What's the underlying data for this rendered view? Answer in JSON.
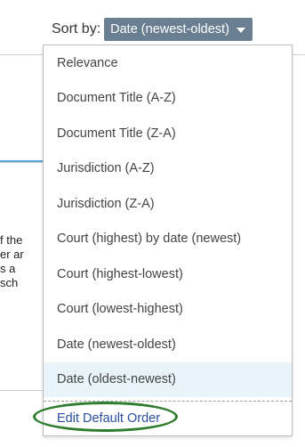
{
  "sort": {
    "label": "Sort by:",
    "selected": "Date (newest-oldest)"
  },
  "menu": {
    "items": [
      {
        "label": "Relevance"
      },
      {
        "label": "Document Title (A-Z)"
      },
      {
        "label": "Document Title (Z-A)"
      },
      {
        "label": "Jurisdiction (A-Z)"
      },
      {
        "label": "Jurisdiction (Z-A)"
      },
      {
        "label": "Court (highest) by date (newest)"
      },
      {
        "label": "Court (highest-lowest)"
      },
      {
        "label": "Court (lowest-highest)"
      },
      {
        "label": "Date (newest-oldest)"
      },
      {
        "label": "Date (oldest-newest)"
      }
    ],
    "edit_label": "Edit Default Order"
  },
  "background": {
    "fragments": [
      "f the",
      "er ar",
      "s a",
      "sch"
    ]
  },
  "colors": {
    "select_bg": "#6b7f92",
    "highlight_bg": "#e8f4fa",
    "link": "#2b4e9e",
    "annotation": "#2e7d2e"
  }
}
